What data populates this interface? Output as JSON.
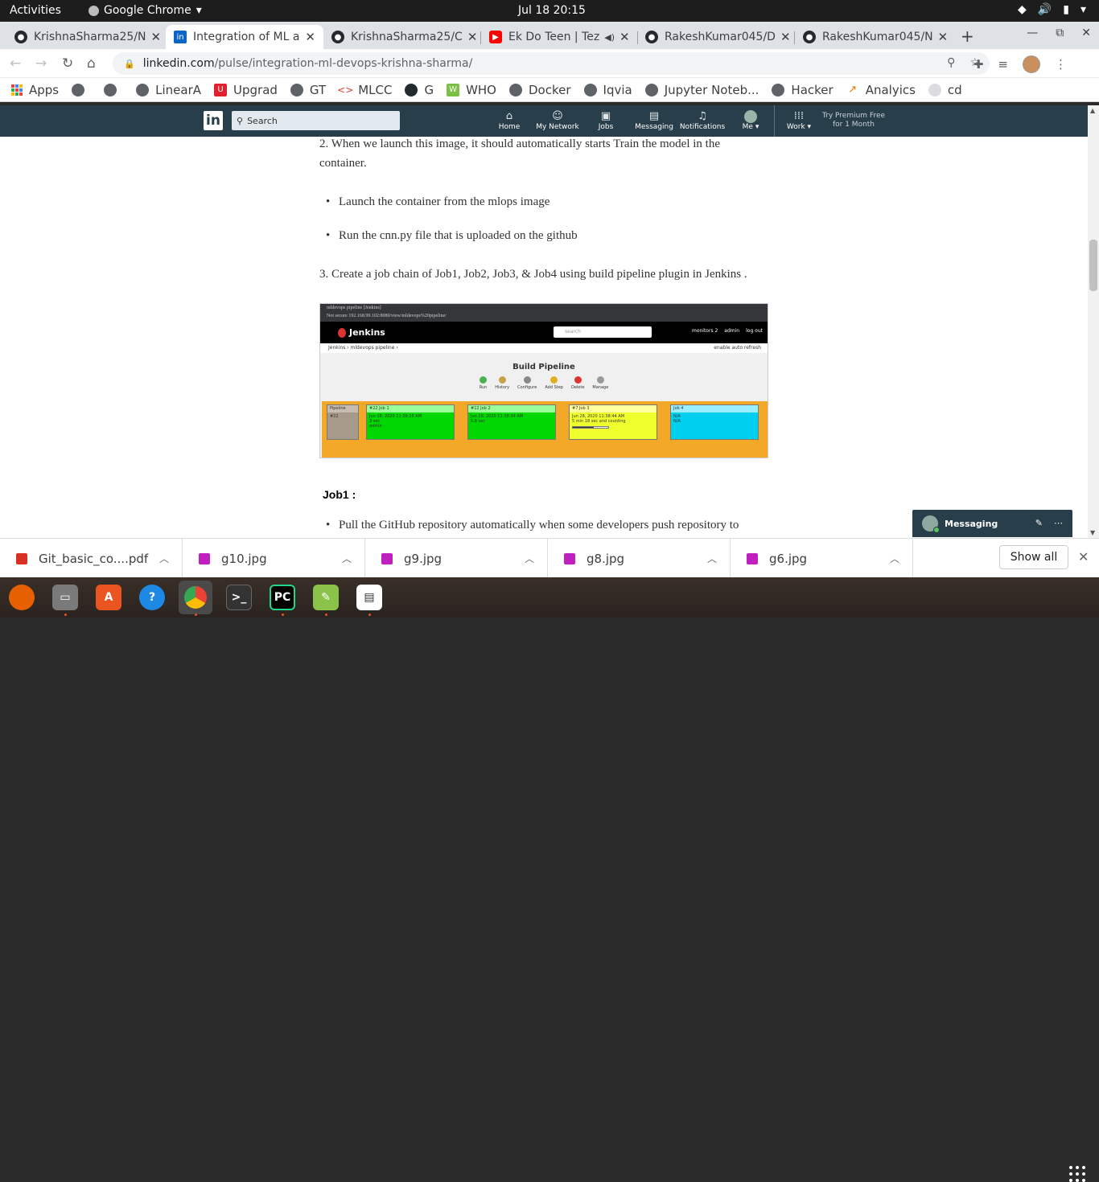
{
  "topbar": {
    "activities": "Activities",
    "app_name": "Google Chrome",
    "clock": "Jul 18  20:15"
  },
  "tabs": [
    {
      "title": "KrishnaSharma25/N",
      "icon": "github-icon",
      "active": false
    },
    {
      "title": "Integration of ML a",
      "icon": "linkedin-icon",
      "active": true
    },
    {
      "title": "KrishnaSharma25/C",
      "icon": "github-icon",
      "active": false
    },
    {
      "title": "Ek Do Teen | Tez",
      "icon": "youtube-icon",
      "active": false
    },
    {
      "title": "RakeshKumar045/D",
      "icon": "github-icon",
      "active": false
    },
    {
      "title": "RakeshKumar045/N",
      "icon": "github-icon",
      "active": false
    }
  ],
  "address": {
    "domain": "linkedin.com",
    "path": "/pulse/integration-ml-devops-krishna-sharma/"
  },
  "bookmarks": [
    {
      "label": "Apps",
      "icon": "apps-grid-icon"
    },
    {
      "label": "",
      "icon": "globe-icon"
    },
    {
      "label": "",
      "icon": "globe-icon"
    },
    {
      "label": "LinearA",
      "icon": "globe-icon"
    },
    {
      "label": "Upgrad",
      "icon": "upgrad-icon"
    },
    {
      "label": "GT",
      "icon": "globe-icon"
    },
    {
      "label": "MLCC",
      "icon": "mlcc-icon"
    },
    {
      "label": "G",
      "icon": "github-icon"
    },
    {
      "label": "WHO",
      "icon": "who-icon"
    },
    {
      "label": "Docker",
      "icon": "globe-icon"
    },
    {
      "label": "Iqvia",
      "icon": "globe-icon"
    },
    {
      "label": "Jupyter Noteb...",
      "icon": "globe-icon"
    },
    {
      "label": "Hacker",
      "icon": "globe-icon"
    },
    {
      "label": "Analyics",
      "icon": "analytics-icon"
    },
    {
      "label": "cd",
      "icon": "globe-icon"
    }
  ],
  "linkedin_nav": {
    "search_placeholder": "Search",
    "items": [
      {
        "label": "Home",
        "icon": "home-icon"
      },
      {
        "label": "My Network",
        "icon": "network-icon"
      },
      {
        "label": "Jobs",
        "icon": "briefcase-icon"
      },
      {
        "label": "Messaging",
        "icon": "messaging-icon"
      },
      {
        "label": "Notifications",
        "icon": "bell-icon"
      },
      {
        "label": "Me ▾",
        "icon": "avatar"
      },
      {
        "label": "Work ▾",
        "icon": "grid-icon"
      }
    ],
    "premium_line1": "Try Premium Free",
    "premium_line2": "for 1 Month"
  },
  "article": {
    "para2_line1": "2. When we launch this image, it should automatically starts Train the model in the",
    "para2_line2": "container.",
    "bullet1": "Launch the container from the mlops image",
    "bullet2": "Run the cnn.py file that is uploaded on the github",
    "para3": "3. Create a job chain of Job1, Job2, Job3, & Job4 using build pipeline plugin in Jenkins .",
    "job1_heading": "Job1 :",
    "job1_bullet": "Pull the GitHub repository automatically when some developers push repository to"
  },
  "jenkins": {
    "tab_title": "mldevops pipeline [Jenkins]",
    "url": "Not secure   192.168.99.102:8080/view/mldevops%20pipeline/",
    "brand": "Jenkins",
    "search_placeholder": "search",
    "monitors": "monitors 2",
    "admin": "admin",
    "logout": "log out",
    "breadcrumb": "Jenkins  ›  mldevops pipeline  ›",
    "auto_refresh": "enable auto refresh",
    "title": "Build Pipeline",
    "actions": [
      "Run",
      "History",
      "Configure",
      "Add Step",
      "Delete",
      "Manage"
    ],
    "pipeline_label": "Pipeline",
    "pipeline_num": "#22",
    "jobs": [
      {
        "name": "#22 Job 1",
        "time": "Jun 28, 2020 11:38:25 AM",
        "dur": "3 sec",
        "user": "admin",
        "color": "#00d600"
      },
      {
        "name": "#12 Job 2",
        "time": "Jun 28, 2020 11:38:34 AM",
        "dur": "5.8 sec",
        "user": "",
        "color": "#00d600"
      },
      {
        "name": "#7 Job 3",
        "time": "Jun 28, 2020 11:38:44 AM",
        "dur": "5 min 18 sec and counting",
        "user": "",
        "color": "#f0ff2e"
      },
      {
        "name": "Job 4",
        "time": "N/A",
        "dur": "N/A",
        "user": "",
        "color": "#00d0f0"
      }
    ]
  },
  "messaging_widget": {
    "label": "Messaging"
  },
  "downloads": [
    {
      "name": "Git_basic_co....pdf",
      "type": "pdf-icon",
      "color": "#d93025"
    },
    {
      "name": "g10.jpg",
      "type": "image-icon",
      "color": "#c020c0"
    },
    {
      "name": "g9.jpg",
      "type": "image-icon",
      "color": "#c020c0"
    },
    {
      "name": "g8.jpg",
      "type": "image-icon",
      "color": "#c020c0"
    },
    {
      "name": "g6.jpg",
      "type": "image-icon",
      "color": "#c020c0"
    }
  ],
  "show_all": "Show all",
  "dock": [
    {
      "icon": "firefox-icon",
      "color": "#e66000"
    },
    {
      "icon": "files-icon",
      "color": "#7a7a7a"
    },
    {
      "icon": "software-center-icon",
      "color": "#e95420"
    },
    {
      "icon": "help-icon",
      "color": "#1e88e5"
    },
    {
      "icon": "chrome-icon",
      "color": "#4285f4"
    },
    {
      "icon": "terminal-icon",
      "color": "#333333"
    },
    {
      "icon": "pycharm-icon",
      "color": "#21d789"
    },
    {
      "icon": "text-editor-icon",
      "color": "#8bc34a"
    },
    {
      "icon": "document-viewer-icon",
      "color": "#ffffff"
    }
  ]
}
